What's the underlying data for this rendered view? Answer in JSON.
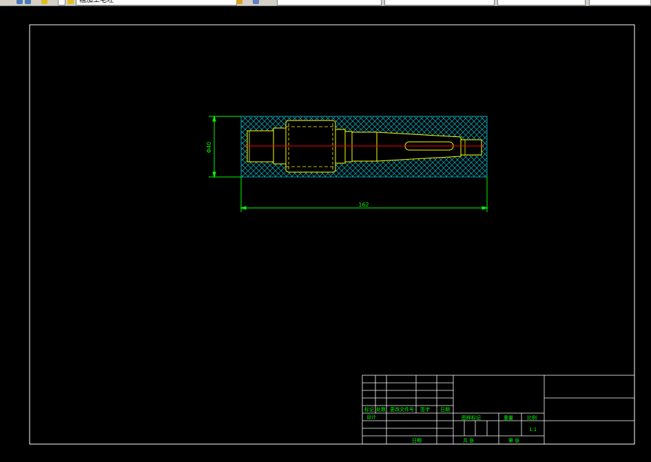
{
  "toolbar": {
    "layer_name": "粗加工毛坯",
    "fields": [
      "",
      "",
      "",
      "",
      ""
    ],
    "colors": {
      "background": "#d4d0c8",
      "field": "#ffffff"
    }
  },
  "drawing": {
    "background": "#000000",
    "dimensions": {
      "length": "162",
      "diameter": "Φ40"
    },
    "colors": {
      "frame": "#ffffff",
      "part_outline": "#ffff00",
      "centerline": "#ff0000",
      "hatch": "#0aa0b0",
      "dimension": "#00ff00",
      "title_text": "#00ff00"
    }
  },
  "title_block": {
    "revision_headers": [
      "标记",
      "处数",
      "更改文件号",
      "签字",
      "日期"
    ],
    "design_label": "设计",
    "date_label": "日期",
    "stage_label": "图样标记",
    "weight_label": "重量",
    "scale_label": "比例",
    "scale_value": "1:1",
    "sheets_total_label": "共 张",
    "sheet_no_label": "第 张"
  }
}
